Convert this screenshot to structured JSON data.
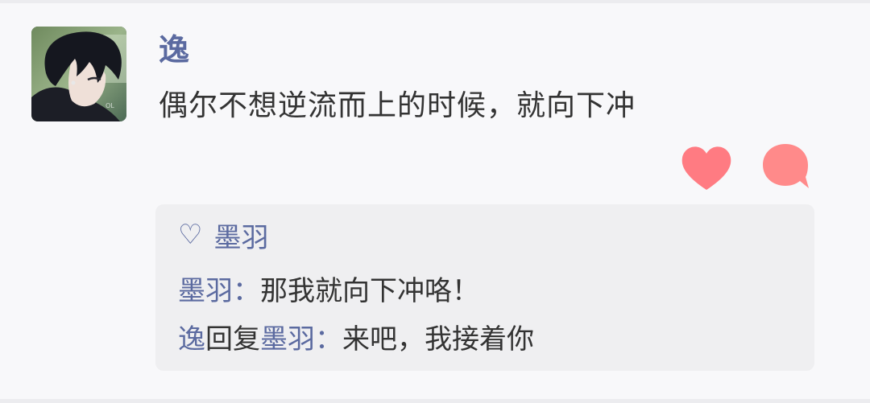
{
  "comment": {
    "author": "逸",
    "text": "偶尔不想逆流而上的时候，就向下冲"
  },
  "actions": {
    "like_icon": "heart-icon",
    "reply_icon": "speech-bubble-icon",
    "like_color": "#ff7b82",
    "reply_color": "#ff8a8a"
  },
  "replies": {
    "liked_by_icon": "heart-outline-icon",
    "liked_by": "墨羽",
    "items": [
      {
        "author": "墨羽",
        "separator": "：",
        "text": "那我就向下冲咯！"
      },
      {
        "author": "逸",
        "reply_word": "回复",
        "target": "墨羽",
        "separator": "：",
        "text": "来吧，我接着你"
      }
    ]
  },
  "colors": {
    "name_link": "#5b6aa0",
    "body_text": "#333333",
    "reply_background": "#efeff1",
    "page_background": "#f8f8fa"
  }
}
